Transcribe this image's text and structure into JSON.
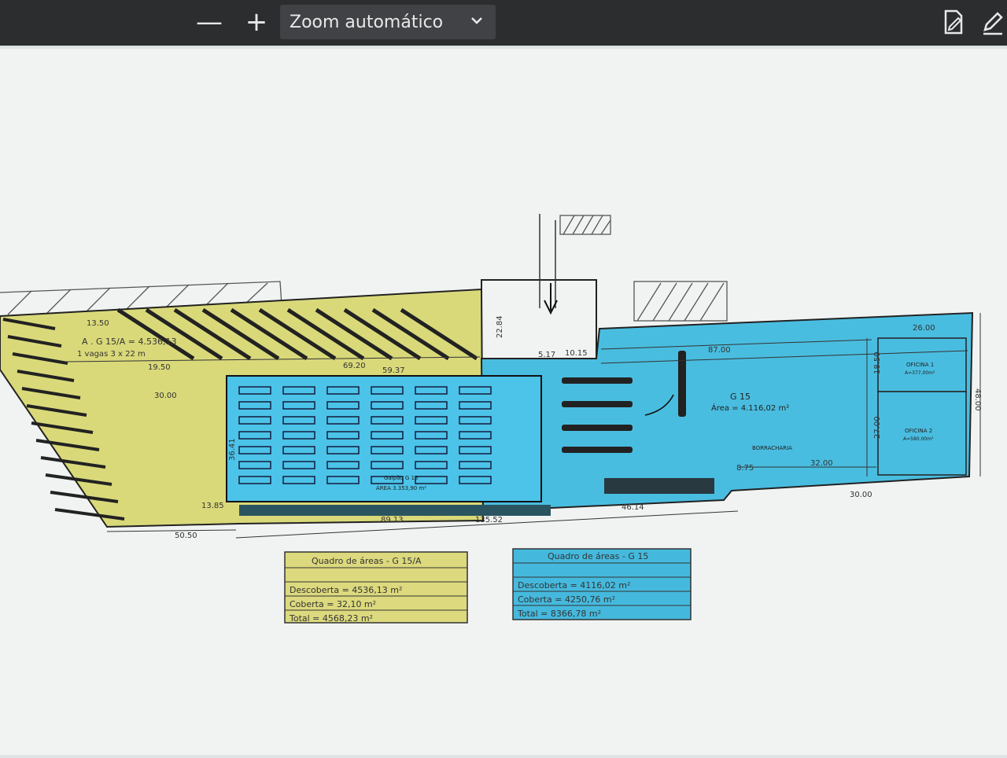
{
  "toolbar": {
    "zoom_out_label": "—",
    "zoom_in_label": "+",
    "zoom_value": "Zoom automático",
    "chevron": "⌄",
    "icons": [
      "edit-pdf-icon",
      "draw-pen-icon"
    ]
  },
  "plan": {
    "colors": {
      "yellow": "#d9d97a",
      "blue": "#49bde0",
      "table_yellow": "#dcd97e",
      "table_blue": "#45b9dd"
    },
    "g15a_title": "A . G 15/A = 4.536,13",
    "g15a_vagas": "1 vagas 3 x 22 m",
    "g15_label": "G 15",
    "g15_area": "Área = 4.116,02 m²",
    "galpao_label": "Galpão G 15",
    "galpao_area": "ÁREA 3.353,90 m²",
    "oficina1": "OFICINA 1",
    "oficina1_area": "A=377,00m²",
    "oficina2": "OFICINA 2",
    "oficina2_area": "A=580,00m²",
    "borracharia": "BORRACHARIA",
    "dimensions": {
      "d1": "13.50",
      "d2": "19.50",
      "d3": "30.00",
      "d4": "69.20",
      "d5": "59.37",
      "d6": "22.84",
      "d7": "5.17",
      "d8": "10.15",
      "d9": "87.00",
      "d10": "26.00",
      "d11": "18.50",
      "d12": "27.00",
      "d13": "32.00",
      "d14": "8.75",
      "d15": "48.00",
      "d16": "36.41",
      "d17": "13.85",
      "d18": "50.50",
      "d19": "89.13",
      "d20": "135.52",
      "d21": "46.14",
      "d22": "30.00"
    }
  },
  "table_g15a": {
    "title": "Quadro de áreas - G 15/A",
    "rows": [
      "Descoberta = 4536,13 m²",
      "Coberta = 32,10 m²",
      "Total = 4568,23 m²"
    ]
  },
  "table_g15": {
    "title": "Quadro de áreas - G 15",
    "rows": [
      "Descoberta = 4116,02 m²",
      "Coberta = 4250,76 m²",
      "Total = 8366,78 m²"
    ]
  }
}
